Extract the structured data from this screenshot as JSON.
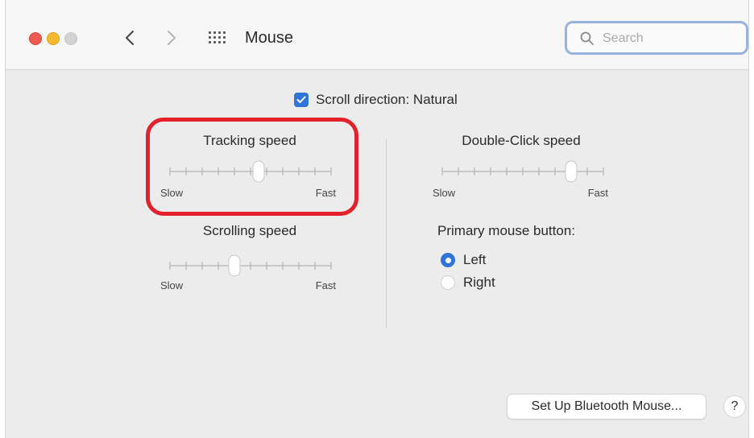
{
  "window": {
    "title": "Mouse"
  },
  "search": {
    "placeholder": "Search"
  },
  "scroll_direction": {
    "label": "Scroll direction: Natural",
    "checked": true
  },
  "tracking": {
    "title": "Tracking speed",
    "min_label": "Slow",
    "max_label": "Fast",
    "value": 0.55
  },
  "scrolling": {
    "title": "Scrolling speed",
    "min_label": "Slow",
    "max_label": "Fast",
    "value": 0.4
  },
  "double_click": {
    "title": "Double-Click speed",
    "min_label": "Slow",
    "max_label": "Fast",
    "value": 0.8
  },
  "primary_button": {
    "title": "Primary mouse button:",
    "options": [
      "Left",
      "Right"
    ],
    "selected": "Left"
  },
  "footer": {
    "bluetooth_label": "Set Up Bluetooth Mouse...",
    "help_label": "?"
  },
  "colors": {
    "accent": "#2f74d8",
    "highlight": "#e4202b"
  }
}
